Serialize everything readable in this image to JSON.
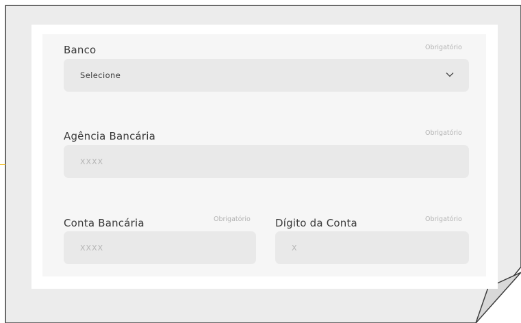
{
  "form": {
    "bank": {
      "label": "Banco",
      "required": "Obrigatório",
      "value": "Selecione",
      "icon": "chevron-down-icon"
    },
    "agency": {
      "label": "Agência Bancária",
      "required": "Obrigatório",
      "placeholder": "XXXX"
    },
    "account": {
      "label": "Conta Bancária",
      "required": "Obrigatório",
      "placeholder": "XXXX"
    },
    "digit": {
      "label": "Dígito da Conta",
      "required": "Obrigatório",
      "placeholder": "X"
    }
  },
  "colors": {
    "background": "#ececec",
    "field": "#e9e9e9",
    "accent_line": "#f3c12b"
  }
}
